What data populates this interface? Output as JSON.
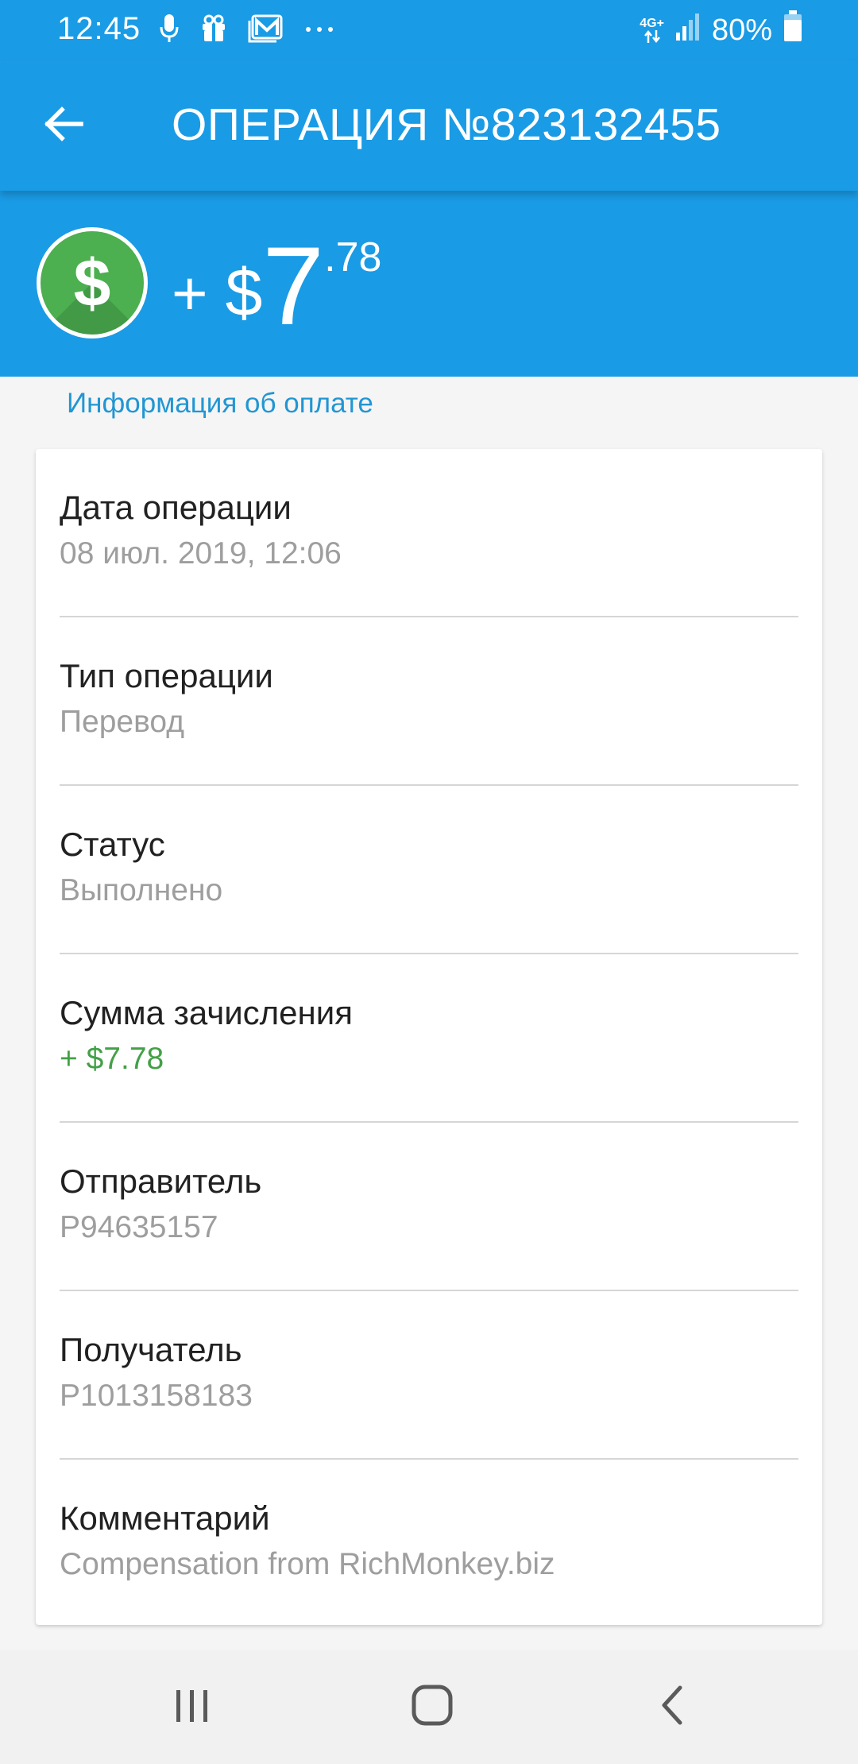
{
  "status_bar": {
    "time": "12:45",
    "network_type": "4G+",
    "battery_percent": "80%",
    "icons": [
      "microphone-icon",
      "gift-icon",
      "mail-icon",
      "more-dots-icon",
      "network-arrows-icon",
      "signal-icon",
      "battery-icon"
    ]
  },
  "app_bar": {
    "title": "ОПЕРАЦИЯ №823132455",
    "back_icon": "arrow-left-icon"
  },
  "amount": {
    "sign": "+",
    "currency": "$",
    "main": "7",
    "cents": ".78",
    "badge_symbol": "$"
  },
  "section": {
    "label": "Информация об оплате"
  },
  "rows": [
    {
      "label": "Дата операции",
      "value": "08 июл. 2019, 12:06"
    },
    {
      "label": "Тип операции",
      "value": "Перевод"
    },
    {
      "label": "Статус",
      "value": "Выполнено"
    },
    {
      "label": "Сумма зачисления",
      "value": "+ $7.78"
    },
    {
      "label": "Отправитель",
      "value": "P94635157"
    },
    {
      "label": "Получатель",
      "value": "P1013158183"
    },
    {
      "label": "Комментарий",
      "value": "Compensation from RichMonkey.biz"
    }
  ],
  "nav_bar": {
    "recents_icon": "recents-icon",
    "home_icon": "home-icon",
    "back_icon": "back-chevron-icon"
  },
  "colors": {
    "primary": "#1a9be5",
    "badge_green": "#4caf50",
    "positive_amount": "#43a047",
    "section_label": "#2196d3"
  }
}
